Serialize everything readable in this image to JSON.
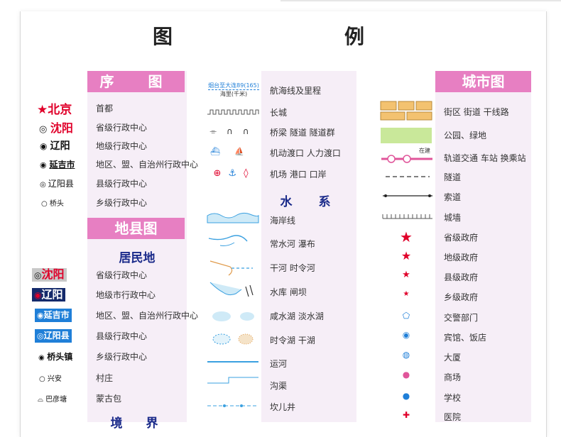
{
  "page_title": "图　　例",
  "left": {
    "header1": "序　图",
    "xutu_items": [
      {
        "symbol": "北京",
        "label": "首都"
      },
      {
        "symbol": "沈阳",
        "label": "省级行政中心"
      },
      {
        "symbol": "辽阳",
        "label": "地级行政中心"
      },
      {
        "symbol": "延吉市",
        "label": "地区、盟、自治州行政中心"
      },
      {
        "symbol": "辽阳县",
        "label": "县级行政中心"
      },
      {
        "symbol": "桥头",
        "label": "乡级行政中心"
      }
    ],
    "header2": "地县图",
    "sub1": "居民地",
    "dixian_items": [
      {
        "symbol": "沈阳",
        "label": "省级行政中心"
      },
      {
        "symbol": "辽阳",
        "label": "地级市行政中心"
      },
      {
        "symbol": "延吉市",
        "label": "地区、盟、自治州行政中心"
      },
      {
        "symbol": "辽阳县",
        "label": "县级行政中心"
      },
      {
        "symbol": "桥头镇",
        "label": "乡级行政中心"
      },
      {
        "symbol": "兴安",
        "label": "村庄"
      },
      {
        "symbol": "巴彦塘",
        "label": "蒙古包"
      }
    ],
    "sub2": "境　界"
  },
  "middle": {
    "items_top": [
      {
        "label": "航海线及里程",
        "sym_text_top": "烟台至大连89(165)",
        "sym_text_bottom": "海里(千米)"
      },
      {
        "label": "长城"
      },
      {
        "label": "桥梁  隧道  隧道群"
      },
      {
        "label": "机动渡口  人力渡口"
      },
      {
        "label": "机场  港口  口岸"
      }
    ],
    "sub": "水　系",
    "items_water": [
      {
        "label": "海岸线"
      },
      {
        "label": "常水河  瀑布"
      },
      {
        "label": "干河  时令河"
      },
      {
        "label": "水库  闸坝"
      },
      {
        "label": "咸水湖  淡水湖"
      },
      {
        "label": "时令湖  干湖"
      },
      {
        "label": "运河"
      },
      {
        "label": "沟渠"
      },
      {
        "label": "坎儿井"
      }
    ]
  },
  "right": {
    "header": "城市图",
    "items": [
      {
        "label": "街区  街道  干线路"
      },
      {
        "label": "公园、绿地"
      },
      {
        "label": "轨道交通  车站  换乘站",
        "sym_text": "在建"
      },
      {
        "label": "隧道"
      },
      {
        "label": "索道"
      },
      {
        "label": "城墙"
      },
      {
        "label": "省级政府"
      },
      {
        "label": "地级政府"
      },
      {
        "label": "县级政府"
      },
      {
        "label": "乡级政府"
      },
      {
        "label": "交警部门"
      },
      {
        "label": "宾馆、饭店"
      },
      {
        "label": "大厦"
      },
      {
        "label": "商场"
      },
      {
        "label": "学校"
      },
      {
        "label": "医院"
      }
    ]
  },
  "colors": {
    "pink_header": "#e77fc2",
    "panel": "#f6eef7",
    "red": "#e0002a",
    "blue": "#1f7fd8",
    "navy": "#142a6b"
  }
}
